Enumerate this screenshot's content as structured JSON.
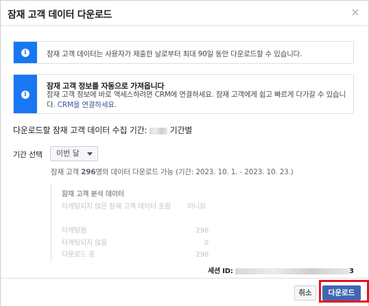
{
  "dialog": {
    "title": "잠재 고객 데이터 다운로드",
    "close_symbol": "×"
  },
  "notice1": {
    "icon": "info-icon",
    "text": "잠재 고객 데이터는 사용자가 제출한 날로부터 최대 90일 동안 다운로드할 수 있습니다."
  },
  "notice2": {
    "icon": "info-icon",
    "title": "잠재 고객 정보를 자동으로 가져옵니다",
    "body_prefix": "잠재 고객 정보에 바로 액세스하려면 CRM에 연결하세요. 잠재 고객에게 쉽고 빠르게 다가갈 수 있습니다.",
    "link": "CRM을 연결하세요."
  },
  "period": {
    "prefix": "다운로드할 잠재 고객 데이터 수집 기간:",
    "suffix": "기간별"
  },
  "select": {
    "label": "기간 선택",
    "value": "이번 달"
  },
  "availability": {
    "prefix": "잠재 고객 ",
    "count": "296",
    "suffix": "명의 데이터 다운로드 가능 (기간: 2023. 10. 1. - 2023. 10. 23.)"
  },
  "analysis": {
    "title": "잠재 고객 분석 데이터",
    "rows": [
      {
        "label": "타게팅되지 않은 잠재 고객 데이터 포함",
        "value": "아니요"
      },
      {
        "label": "타게팅됨",
        "value": "296"
      },
      {
        "label": "타게팅되지 않음",
        "value": "0"
      },
      {
        "label": "다운로드 중",
        "value": "296"
      }
    ]
  },
  "session": {
    "label": "세션 ID:",
    "tail": "3"
  },
  "footer": {
    "cancel_label": "취소",
    "download_label": "다운로드"
  },
  "colors": {
    "accent": "#1877f2",
    "primary_button": "#4267b2",
    "highlight": "#e8111a"
  }
}
